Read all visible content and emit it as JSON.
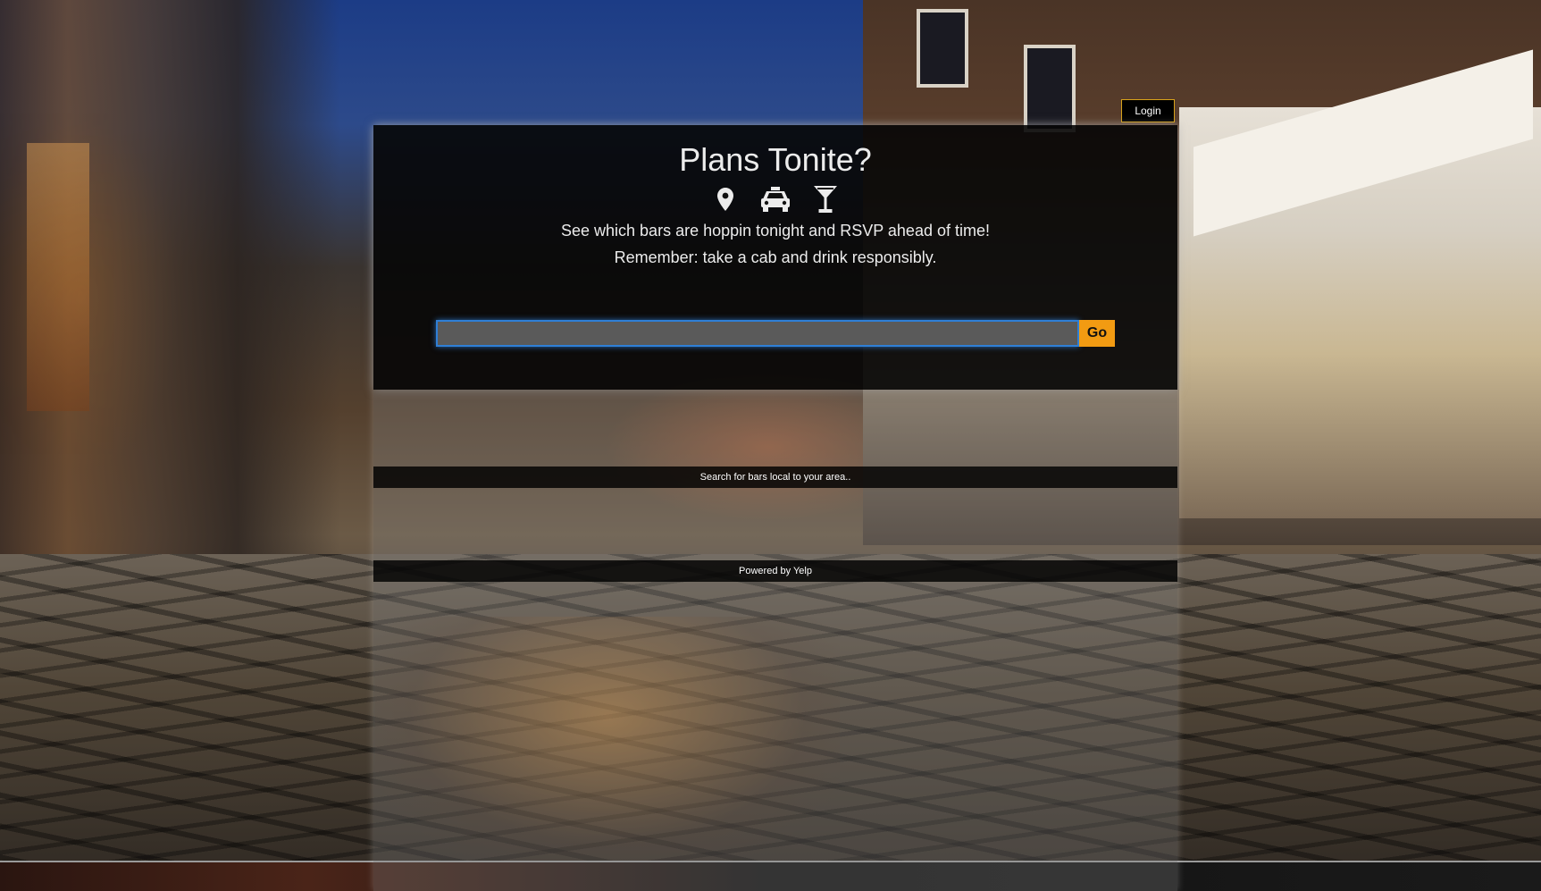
{
  "header": {
    "login_label": "Login"
  },
  "hero": {
    "title": "Plans Tonite?",
    "icons": [
      "map-marker-icon",
      "taxi-icon",
      "cocktail-glass-icon"
    ],
    "tagline_1": "See which bars are hoppin tonight and RSVP ahead of time!",
    "tagline_2": "Remember: take a cab and drink responsibly."
  },
  "search": {
    "value": "",
    "placeholder": "",
    "button_label": "Go"
  },
  "status": {
    "message": "Search for bars local to your area.."
  },
  "footer": {
    "powered_by": "Powered by Yelp"
  },
  "colors": {
    "accent": "#f29b12",
    "input_focus": "#2f7fd6",
    "login_border": "#d8a21a"
  }
}
